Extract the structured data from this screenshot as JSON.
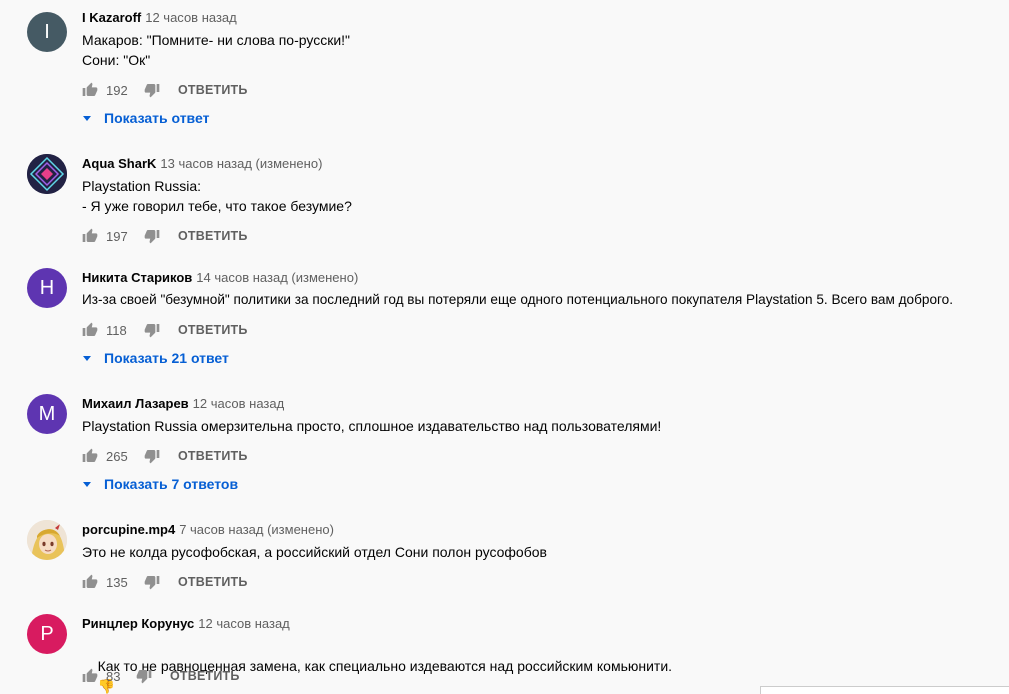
{
  "reply_label": "ОТВЕТИТЬ",
  "comments": [
    {
      "author": "I Kazaroff",
      "time": "12 часов назад",
      "avatar_letter": "I",
      "avatar_color": "#455a64",
      "lines": [
        "Макаров: \"Помните- ни слова по-русски!\"",
        "Сони: \"Ок\""
      ],
      "likes": "192",
      "show_replies": "Показать ответ"
    },
    {
      "author": "Aqua SharK",
      "time": "13 часов назад (изменено)",
      "avatar_letter": "",
      "avatar_color": "#1b1b3a",
      "lines": [
        "Playstation Russia:",
        "- Я уже говорил тебе, что такое безумие?"
      ],
      "likes": "197"
    },
    {
      "author": "Никита Стариков",
      "time": "14 часов назад (изменено)",
      "avatar_letter": "H",
      "avatar_color": "#5e35b1",
      "lines": [
        "Из-за своей \"безумной\" политики за последний год вы потеряли еще одного потенциального покупателя Playstation 5. Всего вам доброго."
      ],
      "likes": "118",
      "show_replies": "Показать 21 ответ"
    },
    {
      "author": "Михаил Лазарев",
      "time": "12 часов назад",
      "avatar_letter": "M",
      "avatar_color": "#5e35b1",
      "lines": [
        "Playstation Russia омерзительна просто, сплошное издавательство над пользователями!"
      ],
      "likes": "265",
      "show_replies": "Показать 7 ответов"
    },
    {
      "author": "porcupine.mp4",
      "time": "7 часов назад (изменено)",
      "avatar_letter": "",
      "avatar_color": "#e8d9c8",
      "lines": [
        "Это не колда русофобская, а российский отдел Сони полон русофобов"
      ],
      "likes": "135"
    },
    {
      "author": "Ринцлер Корунус",
      "time": "12 часов назад",
      "avatar_letter": "P",
      "avatar_color": "#d81b60",
      "lines": [
        "Как то не равноценная замена, как специально издеваются над российским комьюнити."
      ],
      "emoji": "👎",
      "likes": "83"
    }
  ]
}
